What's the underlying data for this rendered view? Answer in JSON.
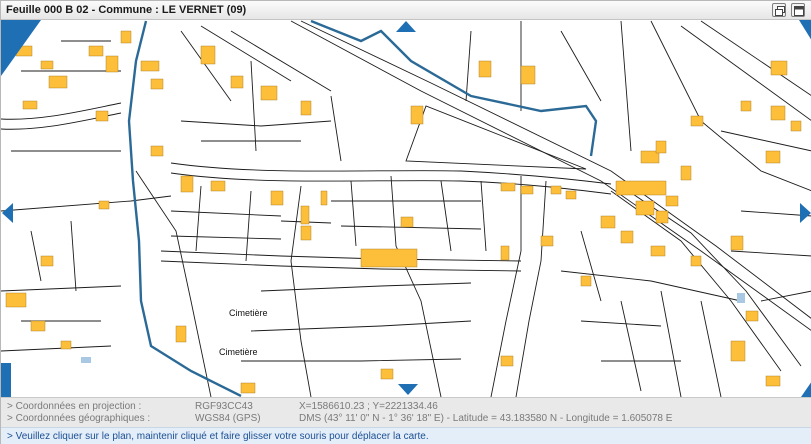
{
  "window": {
    "title": "Feuille 000 B 02 - Commune : LE VERNET (09)"
  },
  "map": {
    "labels": [
      "Cimetière",
      "Cimetière"
    ],
    "colors": {
      "background": "#ffffff",
      "parcel_line": "#1c1c1c",
      "building": "#fdbf3a",
      "building_outline": "#a07018",
      "water_line": "#2b6a96",
      "nav_arrow": "#1f6fb5",
      "info_text": "#1c4f94"
    },
    "nav_icons": [
      "arrow-up-icon",
      "arrow-down-icon",
      "arrow-left-icon",
      "arrow-right-icon"
    ]
  },
  "coordinates": {
    "projection_label": "> Coordonnées en projection :",
    "projection_system": "RGF93CC43",
    "projection_value": "X=1586610.23 ; Y=2221334.46",
    "geographic_label": "> Coordonnées géographiques :",
    "geographic_system": "WGS84 (GPS)",
    "geographic_value": "DMS (43° 11' 0\" N - 1° 36' 18\" E) - Latitude = 43.183580 N - Longitude = 1.605078 E"
  },
  "info": {
    "message": "> Veuillez cliquer sur le plan, maintenir cliqué et faire glisser votre souris pour déplacer la carte."
  }
}
